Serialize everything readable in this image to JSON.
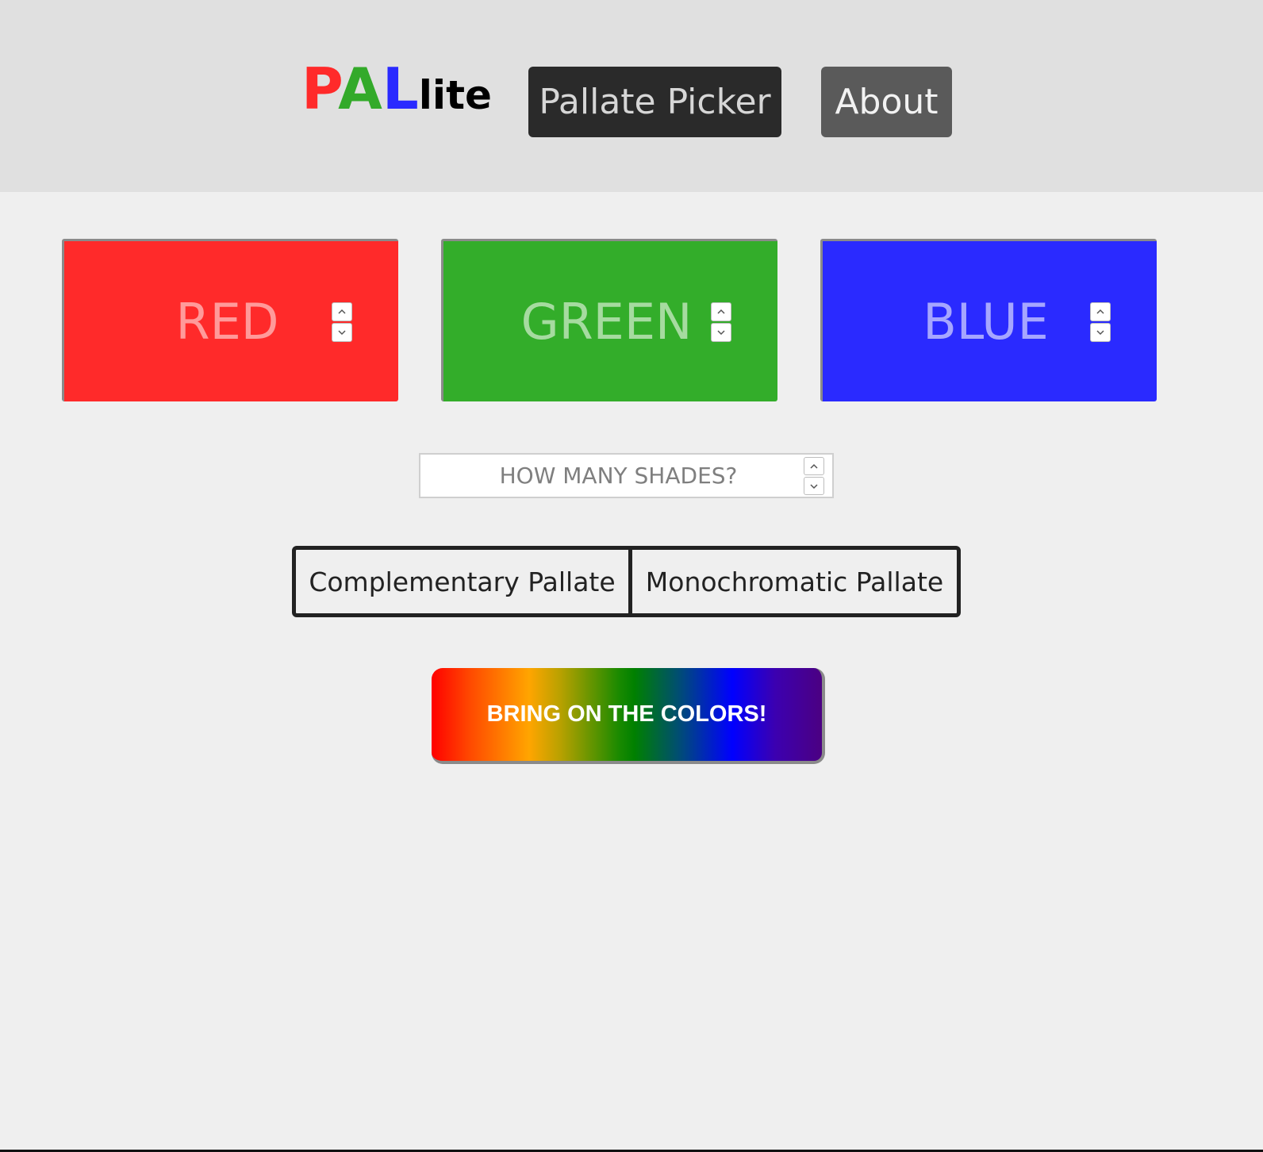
{
  "header": {
    "logo": {
      "letter1": "P",
      "letter2": "A",
      "letter3": "L",
      "suffix": "lite",
      "colors": [
        "#ff2a2a",
        "#33aa2a",
        "#2a2aff",
        "#000000"
      ]
    },
    "nav": {
      "picker_label": "Pallate Picker",
      "about_label": "About"
    }
  },
  "colors": {
    "red": {
      "placeholder": "RED",
      "background": "#ff2a2a",
      "text_color": "#ff9a9a"
    },
    "green": {
      "placeholder": "GREEN",
      "background": "#33ad2a",
      "text_color": "#a6dba0"
    },
    "blue": {
      "placeholder": "BLUE",
      "background": "#2a2aff",
      "text_color": "#a6a6ff"
    }
  },
  "shades": {
    "placeholder": "HOW MANY SHADES?"
  },
  "palette_types": {
    "complementary_label": "Complementary Pallate",
    "monochromatic_label": "Monochromatic Pallate"
  },
  "action": {
    "label": "BRING ON THE COLORS!"
  }
}
